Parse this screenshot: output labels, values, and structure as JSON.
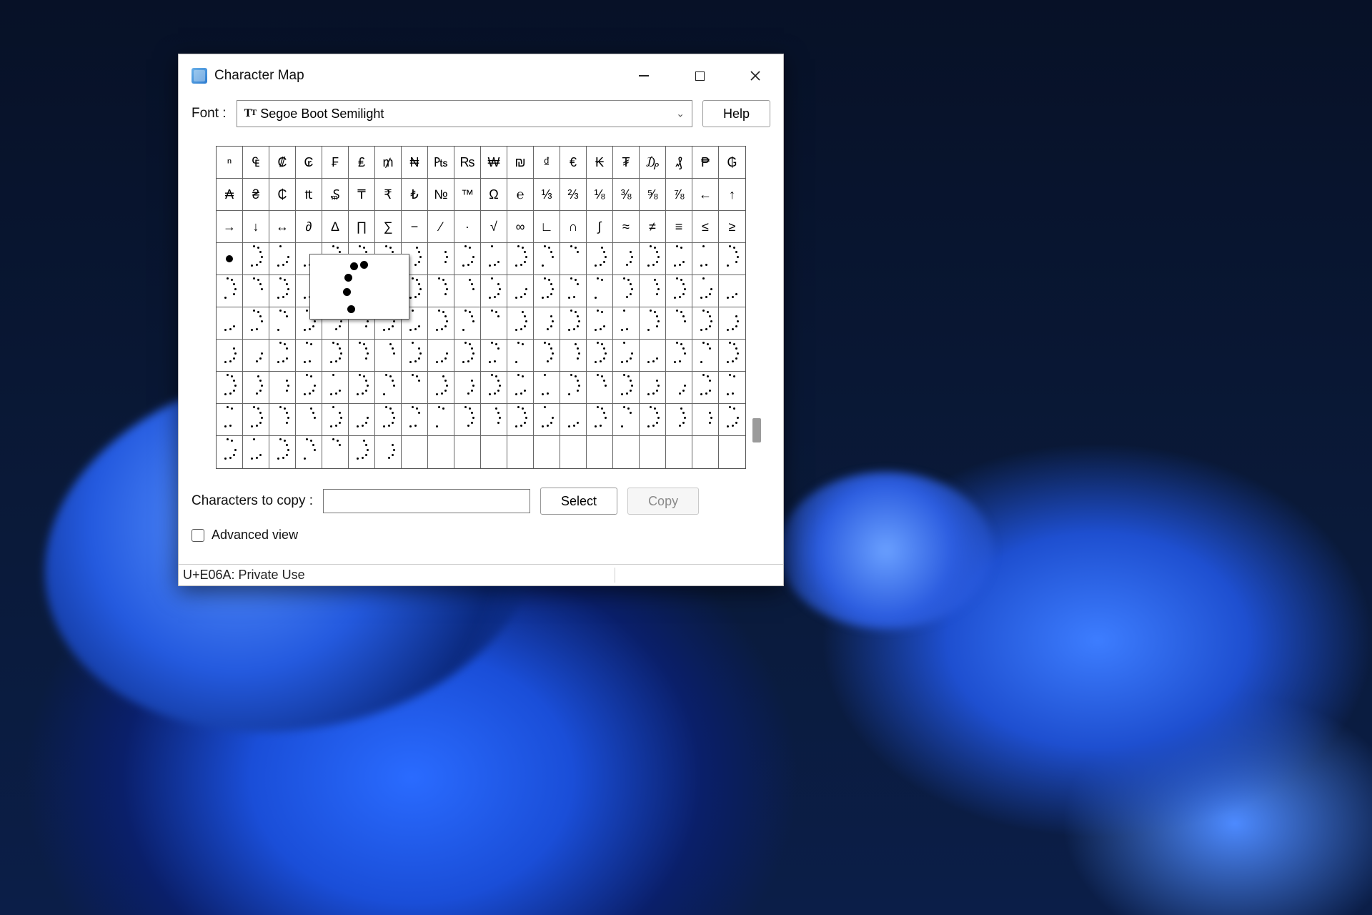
{
  "window": {
    "title": "Character Map",
    "minimize_name": "minimize",
    "maximize_name": "maximize",
    "close_name": "close"
  },
  "labels": {
    "font": "Font :",
    "chars_to_copy": "Characters to copy :",
    "advanced_view": "Advanced view"
  },
  "font_select": {
    "value": "Segoe Boot Semilight"
  },
  "buttons": {
    "help": "Help",
    "select": "Select",
    "copy": "Copy"
  },
  "status": "U+E06A: Private Use",
  "grid": {
    "cols": 20,
    "rows": 10,
    "row0": [
      "ⁿ",
      "₠",
      "₡",
      "₢",
      "₣",
      "₤",
      "₥",
      "₦",
      "₧",
      "₨",
      "₩",
      "₪",
      "₫",
      "€",
      "₭",
      "₮",
      "₯",
      "₰",
      "₱",
      "₲"
    ],
    "row1": [
      "₳",
      "₴",
      "₵",
      "₶",
      "₷",
      "₸",
      "₹",
      "₺",
      "№",
      "™",
      "Ω",
      "℮",
      "⅓",
      "⅔",
      "⅛",
      "⅜",
      "⅝",
      "⅞",
      "←",
      "↑"
    ],
    "row2": [
      "→",
      "↓",
      "↔",
      "∂",
      "∆",
      "∏",
      "∑",
      "−",
      "∕",
      "∙",
      "√",
      "∞",
      "∟",
      "∩",
      "∫",
      "≈",
      "≠",
      "≡",
      "≤",
      "≥"
    ],
    "dot_rows": 6,
    "empty_trailing_cells": 13,
    "big_dot_index": 0
  },
  "preview": {
    "visible": true,
    "glyph_description": "spinner-dots-partial"
  }
}
